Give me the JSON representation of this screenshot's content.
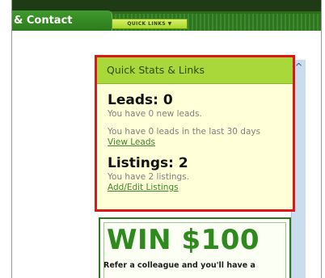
{
  "nav": {
    "tab_label": "& Contact",
    "quick_links_label": "QUICK LINKS ▼"
  },
  "stats": {
    "header": "Quick Stats & Links",
    "leads_title": "Leads: 0",
    "leads_new": "You have 0 new leads.",
    "leads_30days": "You have 0 leads in the last 30 days",
    "view_leads": "View Leads",
    "listings_title": "Listings: 2",
    "listings_count": "You have 2 listings.",
    "add_edit_listings": "Add/Edit Listings"
  },
  "promo": {
    "title": "WIN $100",
    "text": "Refer a colleague and you'll have a"
  },
  "scrollbar": {
    "up_arrow": "^"
  }
}
